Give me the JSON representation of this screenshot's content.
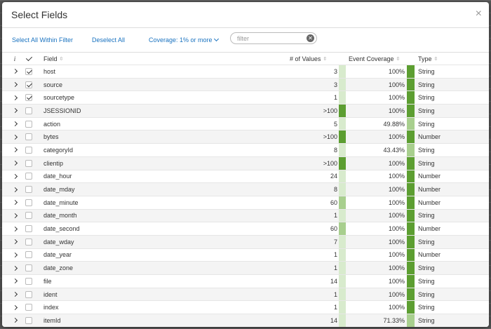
{
  "modal": {
    "title": "Select Fields",
    "close_glyph": "×"
  },
  "toolbar": {
    "select_all_label": "Select All Within Filter",
    "deselect_all_label": "Deselect All",
    "coverage_label": "Coverage: 1% or more",
    "filter_placeholder": "filter",
    "filter_value": ""
  },
  "table": {
    "headers": {
      "info": "i",
      "field": "Field",
      "values": "# of Values",
      "coverage": "Event Coverage",
      "type": "Type"
    },
    "sort_glyph": "⇳",
    "colors": {
      "strong": "#5c9e31",
      "light": "#a8cf8e",
      "pale": "#d8ebcd"
    },
    "rows": [
      {
        "field": "host",
        "checked": true,
        "values": "3",
        "values_level": "pale",
        "coverage": "100%",
        "coverage_level": "strong",
        "type": "String"
      },
      {
        "field": "source",
        "checked": true,
        "values": "3",
        "values_level": "pale",
        "coverage": "100%",
        "coverage_level": "strong",
        "type": "String"
      },
      {
        "field": "sourcetype",
        "checked": true,
        "values": "1",
        "values_level": "pale",
        "coverage": "100%",
        "coverage_level": "strong",
        "type": "String"
      },
      {
        "field": "JSESSIONID",
        "checked": false,
        "values": ">100",
        "values_level": "strong",
        "coverage": "100%",
        "coverage_level": "strong",
        "type": "String"
      },
      {
        "field": "action",
        "checked": false,
        "values": "5",
        "values_level": "pale",
        "coverage": "49.88%",
        "coverage_level": "light",
        "type": "String"
      },
      {
        "field": "bytes",
        "checked": false,
        "values": ">100",
        "values_level": "strong",
        "coverage": "100%",
        "coverage_level": "strong",
        "type": "Number"
      },
      {
        "field": "categoryId",
        "checked": false,
        "values": "8",
        "values_level": "pale",
        "coverage": "43.43%",
        "coverage_level": "light",
        "type": "String"
      },
      {
        "field": "clientip",
        "checked": false,
        "values": ">100",
        "values_level": "strong",
        "coverage": "100%",
        "coverage_level": "strong",
        "type": "String"
      },
      {
        "field": "date_hour",
        "checked": false,
        "values": "24",
        "values_level": "pale",
        "coverage": "100%",
        "coverage_level": "strong",
        "type": "Number"
      },
      {
        "field": "date_mday",
        "checked": false,
        "values": "8",
        "values_level": "pale",
        "coverage": "100%",
        "coverage_level": "strong",
        "type": "Number"
      },
      {
        "field": "date_minute",
        "checked": false,
        "values": "60",
        "values_level": "light",
        "coverage": "100%",
        "coverage_level": "strong",
        "type": "Number"
      },
      {
        "field": "date_month",
        "checked": false,
        "values": "1",
        "values_level": "pale",
        "coverage": "100%",
        "coverage_level": "strong",
        "type": "String"
      },
      {
        "field": "date_second",
        "checked": false,
        "values": "60",
        "values_level": "light",
        "coverage": "100%",
        "coverage_level": "strong",
        "type": "Number"
      },
      {
        "field": "date_wday",
        "checked": false,
        "values": "7",
        "values_level": "pale",
        "coverage": "100%",
        "coverage_level": "strong",
        "type": "String"
      },
      {
        "field": "date_year",
        "checked": false,
        "values": "1",
        "values_level": "pale",
        "coverage": "100%",
        "coverage_level": "strong",
        "type": "Number"
      },
      {
        "field": "date_zone",
        "checked": false,
        "values": "1",
        "values_level": "pale",
        "coverage": "100%",
        "coverage_level": "strong",
        "type": "String"
      },
      {
        "field": "file",
        "checked": false,
        "values": "14",
        "values_level": "pale",
        "coverage": "100%",
        "coverage_level": "strong",
        "type": "String"
      },
      {
        "field": "ident",
        "checked": false,
        "values": "1",
        "values_level": "pale",
        "coverage": "100%",
        "coverage_level": "strong",
        "type": "String"
      },
      {
        "field": "index",
        "checked": false,
        "values": "1",
        "values_level": "pale",
        "coverage": "100%",
        "coverage_level": "strong",
        "type": "String"
      },
      {
        "field": "itemId",
        "checked": false,
        "values": "14",
        "values_level": "pale",
        "coverage": "71.33%",
        "coverage_level": "light",
        "type": "String"
      }
    ]
  }
}
